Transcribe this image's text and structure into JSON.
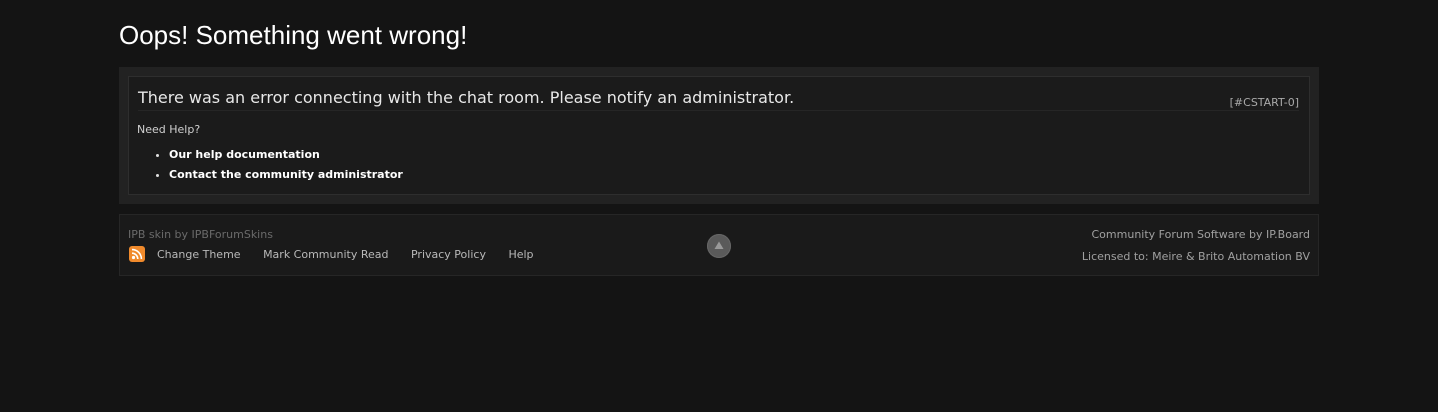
{
  "page": {
    "title": "Oops! Something went wrong!"
  },
  "error": {
    "message": "There was an error connecting with the chat room. Please notify an administrator.",
    "code": "[#CSTART-0]",
    "need_help_label": "Need Help?",
    "help_links": [
      {
        "label": "Our help documentation"
      },
      {
        "label": "Contact the community administrator"
      }
    ]
  },
  "footer": {
    "skin_credit": "IPB skin by IPBForumSkins",
    "rss_icon": "rss-feed-icon",
    "links": [
      {
        "label": "Change Theme"
      },
      {
        "label": "Mark Community Read"
      },
      {
        "label": "Privacy Policy"
      },
      {
        "label": "Help"
      }
    ],
    "back_to_top_icon": "arrow-up-icon",
    "software_credit": "Community Forum Software by IP.Board",
    "license": "Licensed to: Meire & Brito Automation BV"
  },
  "colors": {
    "background": "#141414",
    "panel": "#1b1b1b",
    "rss": "#f08a2c"
  }
}
